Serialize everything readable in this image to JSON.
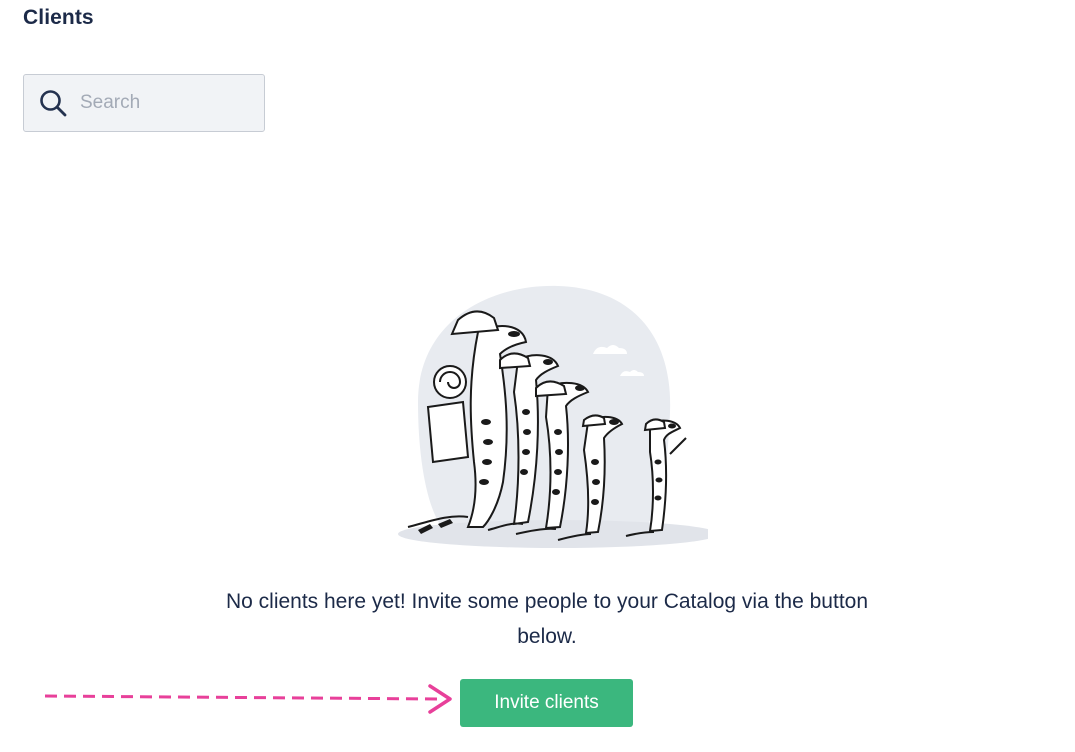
{
  "header": {
    "title": "Clients"
  },
  "search": {
    "placeholder": "Search",
    "value": "",
    "icon": "search-icon"
  },
  "empty_state": {
    "illustration": "meerkats-illustration",
    "message": "No clients here yet! Invite some people to your Catalog via the button below."
  },
  "actions": {
    "invite_label": "Invite clients"
  },
  "colors": {
    "title": "#1c2a48",
    "button_bg": "#3bb77e",
    "annotation_arrow": "#e8409a",
    "search_bg": "#f1f3f6"
  }
}
